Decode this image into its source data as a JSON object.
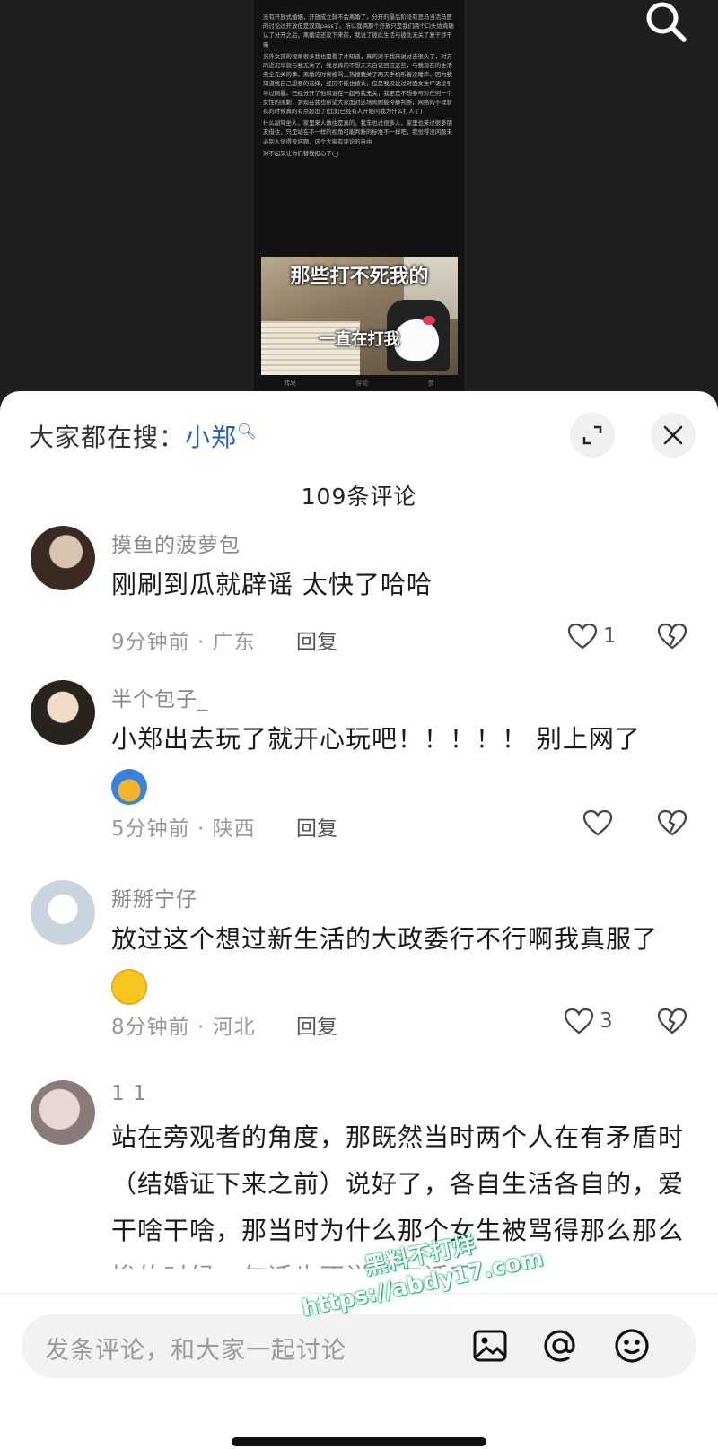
{
  "background_post": {
    "paragraphs": [
      "没有开放式婚姻，开放成立就不会离婚了，分开的最后阶段有恶马当活马医的讨论过开放但是双双pass了。所以我俩那个开放只是我们两个口头协商确认了分开之后，离婚证还没下来前，我说了彼此生活与彼此无关了复干涉干嘛",
      "另外女孩的视角很多我也是看了才知道，真的对于我来说过去很久了，对方的近况早就与我无关了，我也真的不想天天自证回应这些，与我现在的生活完全无关的事。离婚的时候被骂上热搜我关了两天手机听着没睡声，因为我知道我自己想要的选择，经历不能也被认，但是我没说过对面女生坏话没引导过网暴。已经分开了他和谁在一起与我无关，我更是不想参与对任何一个女性的围剿，到现在我也希望大家面对这场闹剧能冷静判断，网络的不理智有的时候真的有点超出了(比如已经有人开始问我为什么打人了)",
      "什么副驾坐人，家里来人做住是真的，我车也过很多人，家里也来过很多朋友借住，只是站在不一样的视角可能判断的标准不一样吧，我觉得没问题未必别人觉得没问题，这个大家有评论的自由",
      "对不起又让你们替我担心了(_)"
    ],
    "meme_top": "那些打不死我的",
    "meme_bottom": "一直在打我",
    "actions": [
      "转发",
      "评论",
      "赞"
    ]
  },
  "header": {
    "search_prefix": "大家都在搜：",
    "search_term": "小郑",
    "comment_count": "109条评论"
  },
  "comments": [
    {
      "username": "摸鱼的菠萝包",
      "text": "刚刷到瓜就辟谣 太快了哈哈",
      "time_location": "9分钟前 · 广东",
      "reply": "回复",
      "likes": "1"
    },
    {
      "username": "半个包子_",
      "text": "小郑出去玩了就开心玩吧！！！！！ 别上网了",
      "time_location": "5分钟前 · 陕西",
      "reply": "回复",
      "likes": ""
    },
    {
      "username": "掰掰宁仔",
      "text": "放过这个想过新生活的大政委行不行啊我真服了",
      "time_location": "8分钟前 · 河北",
      "reply": "回复",
      "likes": "3"
    },
    {
      "username": "1 1",
      "text": "站在旁观者的角度，那既然当时两个人在有矛盾时（结婚证下来之前）说好了，各自生活各自的，爱干啥干啥，那当时为什么那个女生被骂得那么那么惨的时候一句话也不说一句话呢",
      "time_location": "",
      "reply": "",
      "likes": ""
    }
  ],
  "input": {
    "placeholder": "发条评论，和大家一起讨论"
  },
  "watermark": {
    "line1": "黑料不打烊",
    "line2": "https://abdy17.com"
  },
  "colors": {
    "accent_link": "#2a61b5",
    "sheet_bg": "#ffffff",
    "backdrop": "#1f1f1f"
  },
  "icons": [
    "search-icon",
    "expand-icon",
    "close-icon",
    "heart-icon",
    "broken-heart-icon",
    "image-icon",
    "at-icon",
    "emoji-icon"
  ]
}
